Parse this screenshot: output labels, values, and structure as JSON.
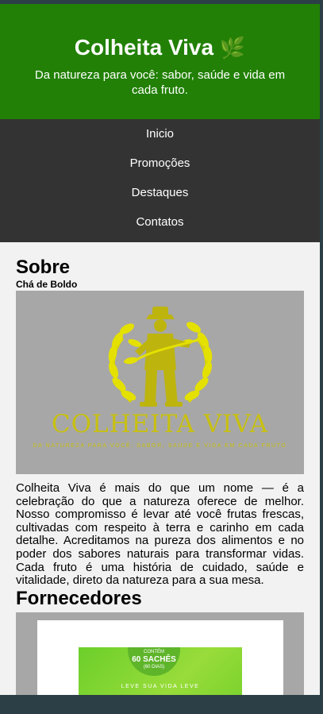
{
  "header": {
    "title": "Colheita Viva",
    "leaf_icon": "🌿",
    "subtitle": "Da natureza para você: sabor, saúde e vida em cada fruto."
  },
  "nav": {
    "items": [
      {
        "label": "Inicio"
      },
      {
        "label": "Promoções"
      },
      {
        "label": "Destaques"
      },
      {
        "label": "Contatos"
      }
    ]
  },
  "about": {
    "heading": "Sobre",
    "subheading": "Chá de Boldo",
    "logo": {
      "name": "COLHEITA VIVA",
      "tagline": "DA NATUREZA PARA VOCÊ: SABOR, SAÚDE E VIDA EM CADA FRUTO"
    },
    "text": "Colheita Viva é mais do que um nome — é a celebração do que a natureza oferece de melhor. Nosso compromisso é levar até você frutas frescas, cultivadas com respeito à terra e carinho em cada detalhe. Acreditamos na pureza dos alimentos e no poder dos sabores naturais para transformar vidas. Cada fruto é uma história de cuidado, saúde e vitalidade, direto da natureza para a sua mesa."
  },
  "suppliers": {
    "heading": "Fornecedores",
    "product": {
      "badge_top": "CONTÉM",
      "badge_main": "60 SACHÊS",
      "badge_bottom": "(60 DIAS)",
      "slogan": "LEVE SUA VIDA LEVE"
    }
  },
  "colors": {
    "header_bg": "#218005",
    "nav_bg": "#333333",
    "logo_yellow": "#c8c010"
  }
}
